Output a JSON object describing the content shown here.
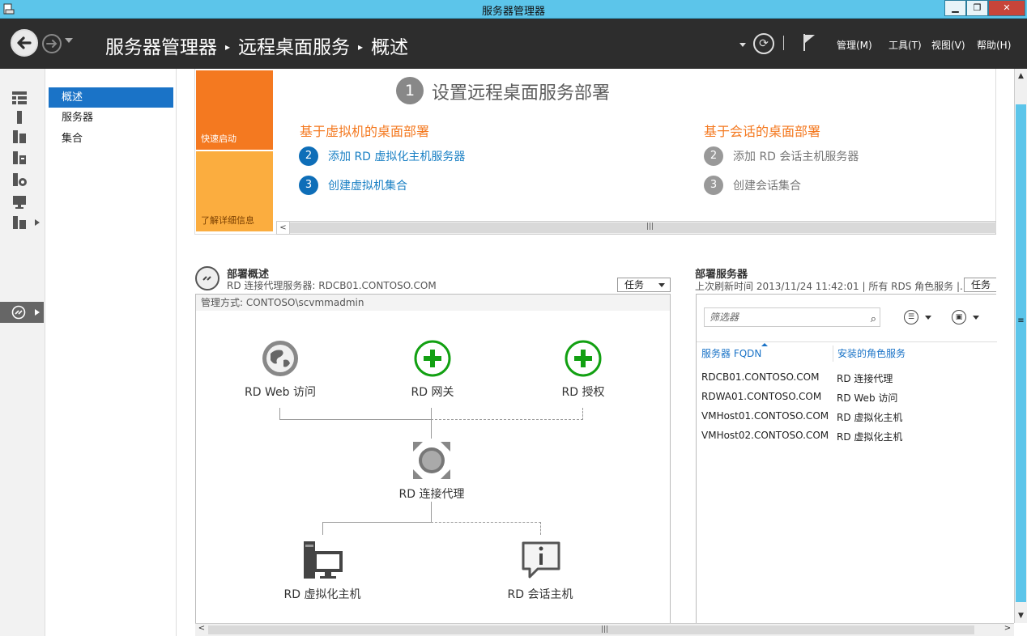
{
  "window": {
    "title": "服务器管理器",
    "min_label": "▁",
    "max_label": "❐",
    "close_label": "✕"
  },
  "header": {
    "breadcrumb": [
      "服务器管理器",
      "远程桌面服务",
      "概述"
    ],
    "sep": "▸",
    "menus": {
      "manage": "管理(M)",
      "tools": "工具(T)",
      "view": "视图(V)",
      "help": "帮助(H)"
    }
  },
  "nav": {
    "items": [
      "概述",
      "服务器",
      "集合"
    ]
  },
  "quickstart": {
    "tile_quick": "快速启动",
    "tile_learn": "了解详细信息",
    "step1_number": "1",
    "step1_title": "设置远程桌面服务部署",
    "vm_title": "基于虚拟机的桌面部署",
    "vm_steps": [
      {
        "num": "2",
        "text": "添加 RD 虚拟化主机服务器"
      },
      {
        "num": "3",
        "text": "创建虚拟机集合"
      }
    ],
    "session_title": "基于会话的桌面部署",
    "session_steps": [
      {
        "num": "2",
        "text": "添加 RD 会话主机服务器"
      },
      {
        "num": "3",
        "text": "创建会话集合"
      }
    ]
  },
  "overview": {
    "title": "部署概述",
    "subtitle": "RD 连接代理服务器: RDCB01.CONTOSO.COM",
    "tasks": "任务",
    "managed_by": "管理方式: CONTOSO\\scvmmadmin",
    "roles": {
      "web": "RD Web 访问",
      "gateway": "RD 网关",
      "licensing": "RD 授权",
      "broker": "RD 连接代理",
      "virt": "RD 虚拟化主机",
      "session": "RD 会话主机"
    }
  },
  "servers": {
    "title": "部署服务器",
    "subtitle": "上次刷新时间 2013/11/24 11:42:01 | 所有 RDS 角色服务  |...",
    "tasks": "任务",
    "filter_placeholder": "筛选器",
    "columns": [
      "服务器 FQDN",
      "安装的角色服务"
    ],
    "rows": [
      [
        "RDCB01.CONTOSO.COM",
        "RD 连接代理"
      ],
      [
        "RDWA01.CONTOSO.COM",
        "RD Web 访问"
      ],
      [
        "VMHost01.CONTOSO.COM",
        "RD 虚拟化主机"
      ],
      [
        "VMHost02.CONTOSO.COM",
        "RD 虚拟化主机"
      ]
    ]
  },
  "colors": {
    "accent": "#1a73c7",
    "orange": "#f47920",
    "gold": "#fbad3f",
    "titlebar": "#5cc5ea",
    "header": "#2d2d2d",
    "add_green": "#12a012"
  }
}
